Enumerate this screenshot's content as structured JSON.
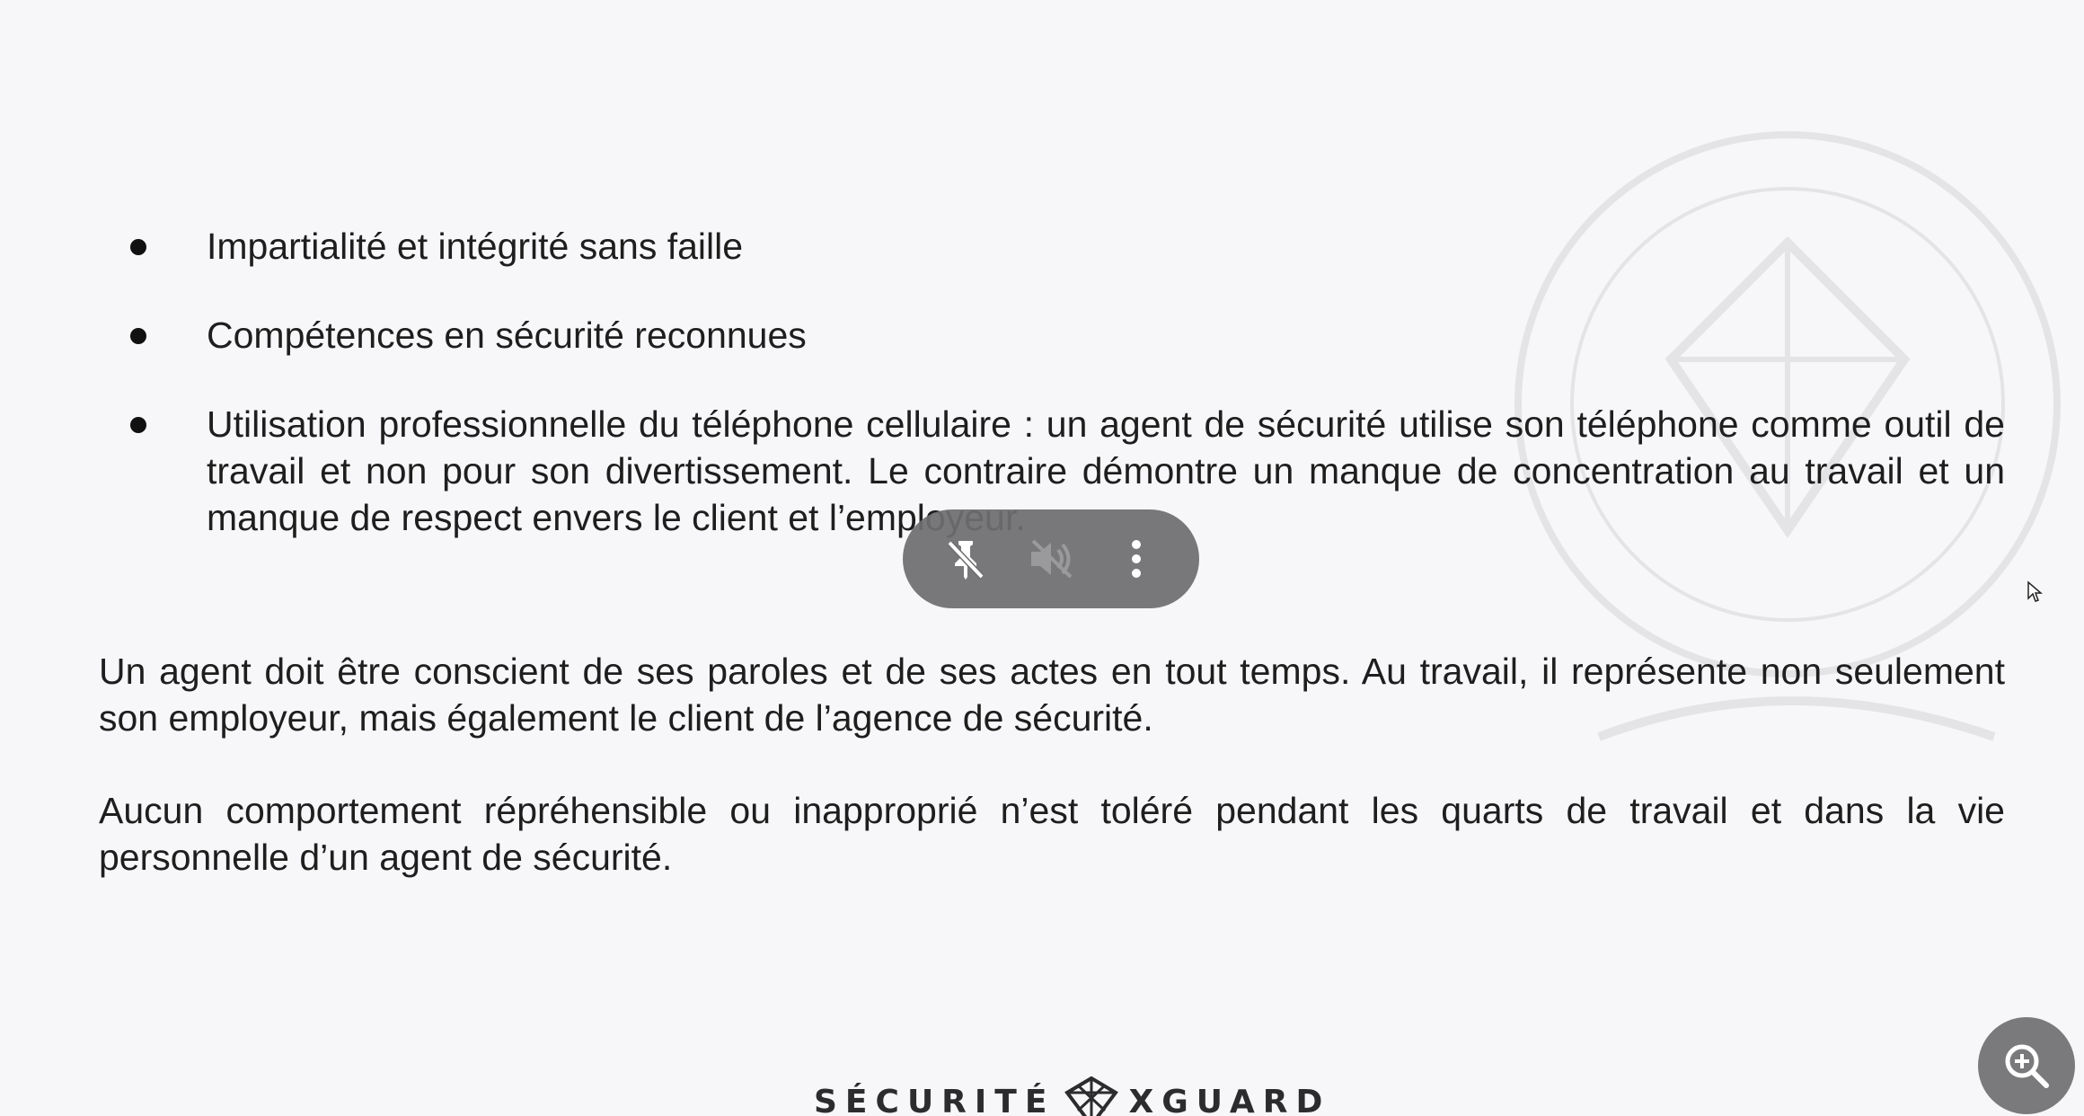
{
  "document": {
    "bullets": [
      {
        "text": "Impartialité et intégrité sans faille"
      },
      {
        "text": "Compétences en sécurité reconnues"
      },
      {
        "text": "Utilisation professionnelle du téléphone cellulaire : un agent de sécurité utilise son téléphone comme outil de travail et non pour son divertissement. Le contraire démontre un manque de concentration au travail et un manque de respect envers le client et l’employeur."
      }
    ],
    "paragraphs": [
      "Un agent doit être conscient de ses paroles et de ses actes en tout temps. Au travail, il représente non seulement son employeur, mais également le client de l’agence de sécurité.",
      "Aucun comportement répréhensible ou inapproprié n’est toléré pendant les quarts de travail et dans la vie personnelle d’un agent de sécurité."
    ]
  },
  "footer": {
    "logo_left": "SÉCURITÉ",
    "logo_right": "XGUARD"
  },
  "controls": {
    "icons": [
      "pin-off-icon",
      "volume-off-icon",
      "more-vertical-icon"
    ],
    "zoom_icon": "zoom-in-icon"
  },
  "colors": {
    "background": "#f7f7f9",
    "text": "#1e1e1e",
    "pill": "#6e6e70",
    "zoom_button": "#7a7a7c"
  }
}
